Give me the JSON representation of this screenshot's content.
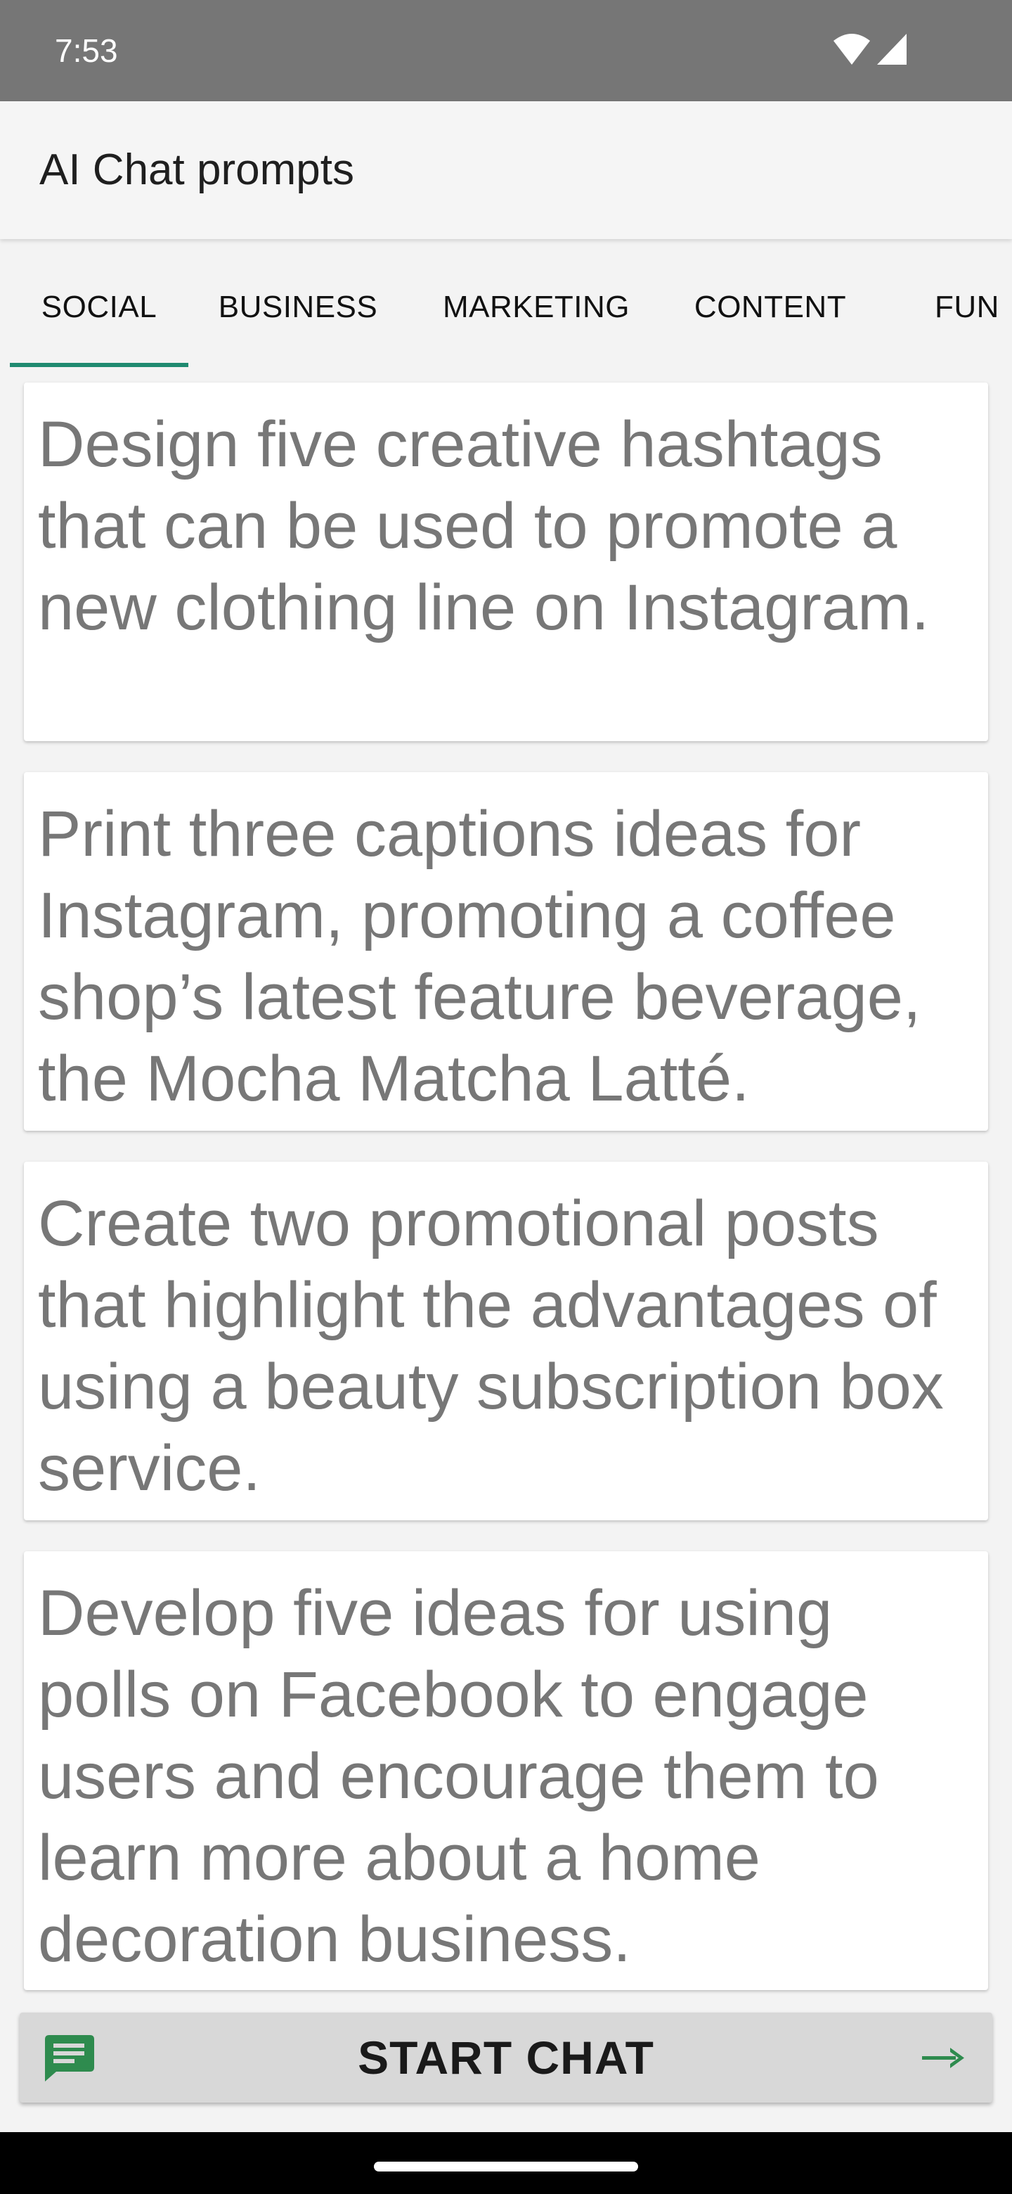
{
  "status_bar": {
    "time": "7:53"
  },
  "app_bar": {
    "title": "AI Chat prompts"
  },
  "tabs": [
    {
      "label": "SOCIAL",
      "selected": true
    },
    {
      "label": "BUSINESS",
      "selected": false
    },
    {
      "label": "MARKETING",
      "selected": false
    },
    {
      "label": "CONTENT",
      "selected": false
    },
    {
      "label": "FUN",
      "selected": false
    }
  ],
  "prompts": [
    {
      "text": "Design five creative hashtags that can be used to promote a new clothing line on Instagram."
    },
    {
      "text": "Print three captions ideas for Instagram, promoting a coffee shop’s latest feature beverage, the Mocha Matcha Latté."
    },
    {
      "text": "Create two promotional posts that highlight the advantages of using a beauty subscription box service."
    },
    {
      "text": "Develop five ideas for using polls on Facebook to engage users and encourage them to learn more about a home decoration business."
    }
  ],
  "start_chat": {
    "label": "START CHAT"
  },
  "colors": {
    "accent": "#1f8a70",
    "status_bar": "#767676",
    "card_text": "#777777"
  },
  "icons": {
    "wifi": "wifi-icon",
    "signal": "cell-signal-icon",
    "chat": "chat-bubble-icon",
    "arrow": "arrow-right-icon"
  }
}
